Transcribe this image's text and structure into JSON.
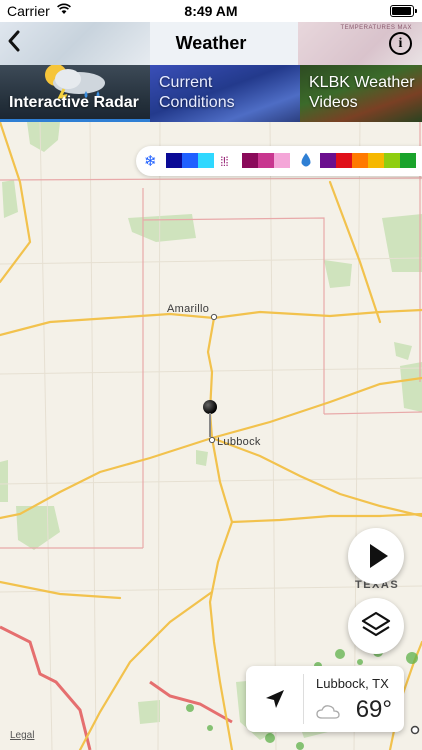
{
  "status_bar": {
    "carrier": "Carrier",
    "time": "8:49 AM",
    "battery_level": 1.0
  },
  "nav": {
    "title": "Weather",
    "background_text": "TEMPERATURES MAX"
  },
  "tabs": [
    {
      "label": "Interactive Radar",
      "selected": true
    },
    {
      "label": "Current Conditions",
      "selected": false
    },
    {
      "label": "KLBK Weather Videos",
      "selected": false
    }
  ],
  "legend": {
    "groups": [
      {
        "icon": "snowflake-icon",
        "colors": [
          "#0a0a96",
          "#1f60ff",
          "#2fd8ff"
        ]
      },
      {
        "icon": "mixed-precip-icon",
        "colors": [
          "#8a0a5a",
          "#c8368f",
          "#f4a6d8"
        ]
      },
      {
        "icon": "raindrop-icon",
        "colors": [
          "#6b0f8e",
          "#e01019",
          "#ff7a00",
          "#f6b800",
          "#8fce10",
          "#1aa32b"
        ]
      }
    ]
  },
  "map": {
    "cities": [
      "Amarillo",
      "Lubbock"
    ],
    "state_label": "TEXAS",
    "legal": "Legal"
  },
  "weather_card": {
    "location": "Lubbock, TX",
    "temperature": "69°"
  },
  "colors": {
    "accent": "#2f7fd4",
    "map_bg": "#f4f1e8",
    "road": "#f2c24d",
    "border": "#e8a9a9"
  }
}
